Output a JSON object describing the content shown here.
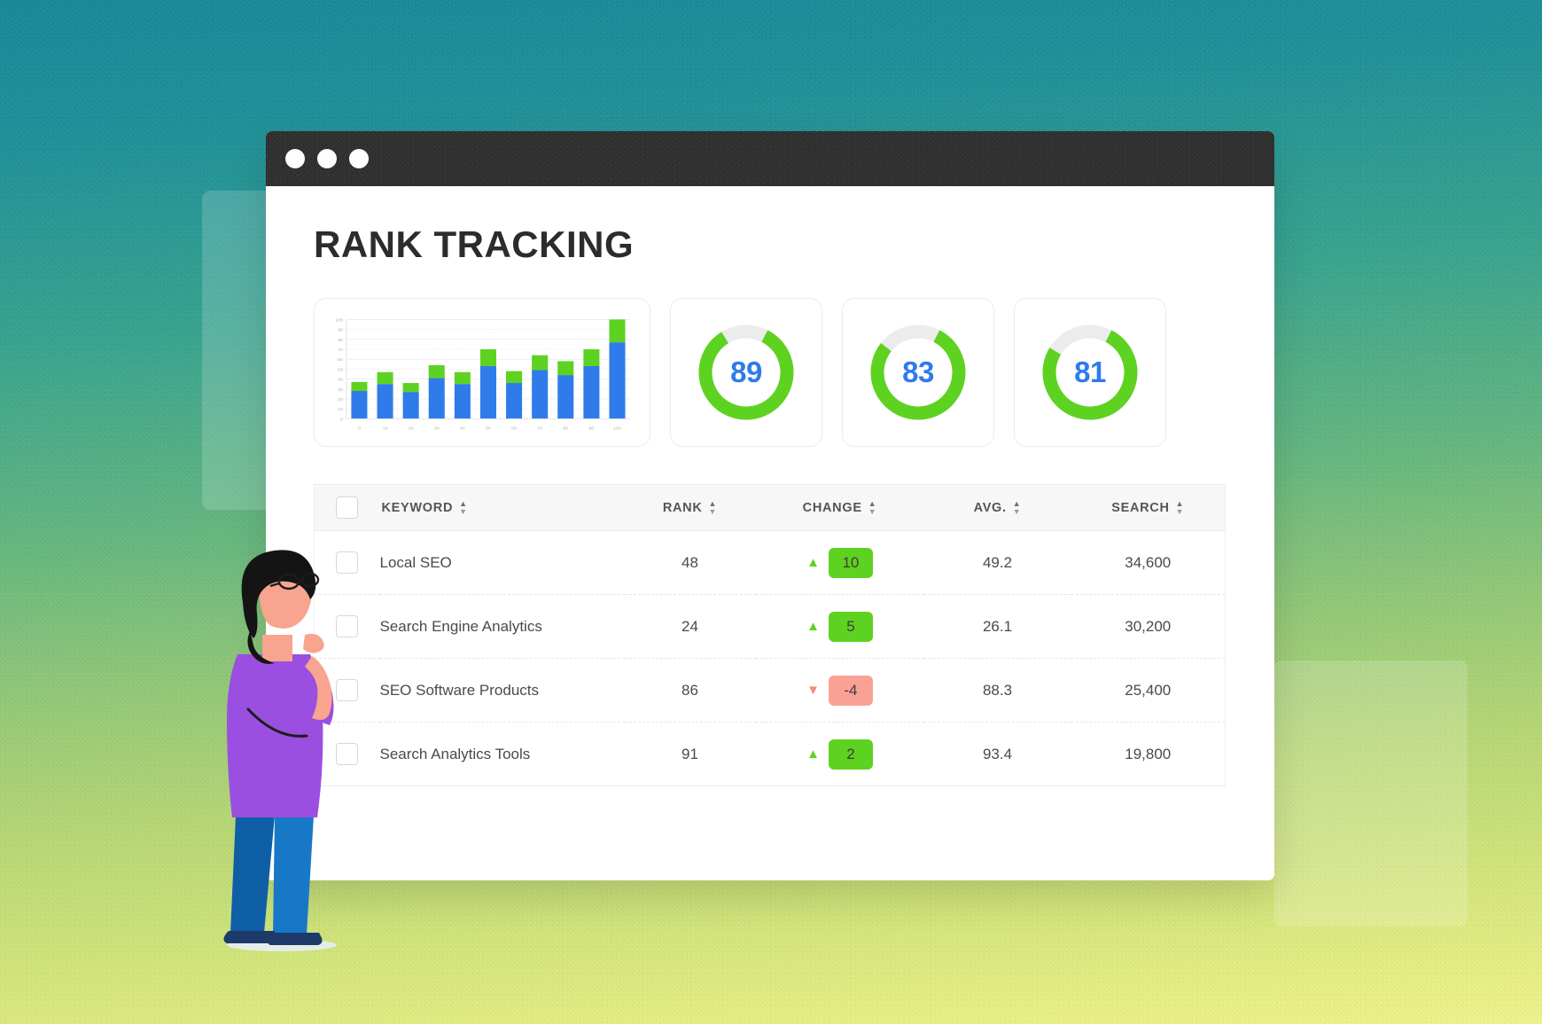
{
  "window": {
    "titlebar_dots": [
      "window-dot-1",
      "window-dot-2",
      "window-dot-3"
    ]
  },
  "page_title": "RANK TRACKING",
  "colors": {
    "accent_blue": "#2f7bea",
    "bar_blue": "#2f7bea",
    "bar_green": "#5ed220",
    "gauge_green": "#5ed220",
    "gauge_track": "#ececec",
    "badge_positive": "#5ed220",
    "badge_negative": "#f9a195",
    "titlebar": "#2b2b2b",
    "title_text": "#2c2c2c"
  },
  "gauges": [
    {
      "name": "gauge-89",
      "value": "89",
      "percent": 89
    },
    {
      "name": "gauge-83",
      "value": "83",
      "percent": 83
    },
    {
      "name": "gauge-81",
      "value": "81",
      "percent": 81
    }
  ],
  "chart_data": {
    "type": "bar",
    "subtype": "stacked-vertical",
    "title": "",
    "xlabel": "",
    "ylabel": "",
    "categories": [
      "0",
      "10",
      "20",
      "30",
      "40",
      "50",
      "60",
      "70",
      "80",
      "90",
      "100"
    ],
    "x_tick_labels": [
      "0",
      "10",
      "20",
      "30",
      "40",
      "50",
      "60",
      "70",
      "80",
      "90",
      "100"
    ],
    "y_tick_labels": [
      "0",
      "10",
      "20",
      "30",
      "40",
      "50",
      "60",
      "70",
      "80",
      "90",
      "100"
    ],
    "ylim": [
      0,
      100
    ],
    "grid": true,
    "legend": "none",
    "series": [
      {
        "name": "blue",
        "color": "#2f7bea",
        "values": [
          28,
          35,
          27,
          41,
          35,
          53,
          36,
          49,
          44,
          53,
          77
        ]
      },
      {
        "name": "green",
        "color": "#5ed220",
        "values": [
          9,
          12,
          9,
          13,
          12,
          17,
          12,
          15,
          14,
          17,
          23
        ]
      }
    ],
    "totals": [
      37,
      47,
      36,
      54,
      47,
      70,
      48,
      64,
      58,
      70,
      100
    ]
  },
  "table": {
    "select_all_name": "select-all-checkbox",
    "columns": [
      {
        "key": "checkbox",
        "label": "",
        "sortable": false
      },
      {
        "key": "keyword",
        "label": "KEYWORD",
        "sortable": true
      },
      {
        "key": "rank",
        "label": "RANK",
        "sortable": true
      },
      {
        "key": "change",
        "label": "CHANGE",
        "sortable": true
      },
      {
        "key": "avg",
        "label": "AVG.",
        "sortable": true
      },
      {
        "key": "search",
        "label": "SEARCH",
        "sortable": true
      }
    ],
    "rows": [
      {
        "keyword": "Local SEO",
        "rank": "48",
        "change": "10",
        "direction": "up",
        "avg": "49.2",
        "search": "34,600"
      },
      {
        "keyword": "Search Engine Analytics",
        "rank": "24",
        "change": "5",
        "direction": "up",
        "avg": "26.1",
        "search": "30,200"
      },
      {
        "keyword": "SEO Software Products",
        "rank": "86",
        "change": "-4",
        "direction": "down",
        "avg": "88.3",
        "search": "25,400"
      },
      {
        "keyword": "Search Analytics Tools",
        "rank": "91",
        "change": "2",
        "direction": "up",
        "avg": "93.4",
        "search": "19,800"
      }
    ]
  },
  "illustration": {
    "name": "person-thinking",
    "hair": "#141414",
    "skin": "#f8a48f",
    "shirt": "#9b4fe0",
    "pants": "#1878c8",
    "pants_shadow": "#0e5fa5",
    "shoes": "#1d3a6b"
  }
}
